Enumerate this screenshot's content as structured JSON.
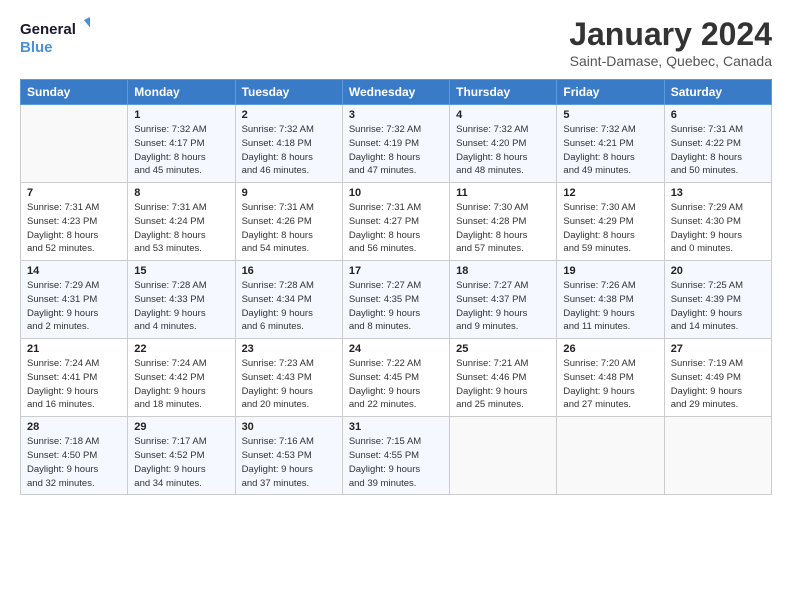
{
  "logo": {
    "line1": "General",
    "line2": "Blue"
  },
  "title": "January 2024",
  "subtitle": "Saint-Damase, Quebec, Canada",
  "days_header": [
    "Sunday",
    "Monday",
    "Tuesday",
    "Wednesday",
    "Thursday",
    "Friday",
    "Saturday"
  ],
  "weeks": [
    [
      {
        "num": "",
        "info": ""
      },
      {
        "num": "1",
        "info": "Sunrise: 7:32 AM\nSunset: 4:17 PM\nDaylight: 8 hours\nand 45 minutes."
      },
      {
        "num": "2",
        "info": "Sunrise: 7:32 AM\nSunset: 4:18 PM\nDaylight: 8 hours\nand 46 minutes."
      },
      {
        "num": "3",
        "info": "Sunrise: 7:32 AM\nSunset: 4:19 PM\nDaylight: 8 hours\nand 47 minutes."
      },
      {
        "num": "4",
        "info": "Sunrise: 7:32 AM\nSunset: 4:20 PM\nDaylight: 8 hours\nand 48 minutes."
      },
      {
        "num": "5",
        "info": "Sunrise: 7:32 AM\nSunset: 4:21 PM\nDaylight: 8 hours\nand 49 minutes."
      },
      {
        "num": "6",
        "info": "Sunrise: 7:31 AM\nSunset: 4:22 PM\nDaylight: 8 hours\nand 50 minutes."
      }
    ],
    [
      {
        "num": "7",
        "info": "Sunrise: 7:31 AM\nSunset: 4:23 PM\nDaylight: 8 hours\nand 52 minutes."
      },
      {
        "num": "8",
        "info": "Sunrise: 7:31 AM\nSunset: 4:24 PM\nDaylight: 8 hours\nand 53 minutes."
      },
      {
        "num": "9",
        "info": "Sunrise: 7:31 AM\nSunset: 4:26 PM\nDaylight: 8 hours\nand 54 minutes."
      },
      {
        "num": "10",
        "info": "Sunrise: 7:31 AM\nSunset: 4:27 PM\nDaylight: 8 hours\nand 56 minutes."
      },
      {
        "num": "11",
        "info": "Sunrise: 7:30 AM\nSunset: 4:28 PM\nDaylight: 8 hours\nand 57 minutes."
      },
      {
        "num": "12",
        "info": "Sunrise: 7:30 AM\nSunset: 4:29 PM\nDaylight: 8 hours\nand 59 minutes."
      },
      {
        "num": "13",
        "info": "Sunrise: 7:29 AM\nSunset: 4:30 PM\nDaylight: 9 hours\nand 0 minutes."
      }
    ],
    [
      {
        "num": "14",
        "info": "Sunrise: 7:29 AM\nSunset: 4:31 PM\nDaylight: 9 hours\nand 2 minutes."
      },
      {
        "num": "15",
        "info": "Sunrise: 7:28 AM\nSunset: 4:33 PM\nDaylight: 9 hours\nand 4 minutes."
      },
      {
        "num": "16",
        "info": "Sunrise: 7:28 AM\nSunset: 4:34 PM\nDaylight: 9 hours\nand 6 minutes."
      },
      {
        "num": "17",
        "info": "Sunrise: 7:27 AM\nSunset: 4:35 PM\nDaylight: 9 hours\nand 8 minutes."
      },
      {
        "num": "18",
        "info": "Sunrise: 7:27 AM\nSunset: 4:37 PM\nDaylight: 9 hours\nand 9 minutes."
      },
      {
        "num": "19",
        "info": "Sunrise: 7:26 AM\nSunset: 4:38 PM\nDaylight: 9 hours\nand 11 minutes."
      },
      {
        "num": "20",
        "info": "Sunrise: 7:25 AM\nSunset: 4:39 PM\nDaylight: 9 hours\nand 14 minutes."
      }
    ],
    [
      {
        "num": "21",
        "info": "Sunrise: 7:24 AM\nSunset: 4:41 PM\nDaylight: 9 hours\nand 16 minutes."
      },
      {
        "num": "22",
        "info": "Sunrise: 7:24 AM\nSunset: 4:42 PM\nDaylight: 9 hours\nand 18 minutes."
      },
      {
        "num": "23",
        "info": "Sunrise: 7:23 AM\nSunset: 4:43 PM\nDaylight: 9 hours\nand 20 minutes."
      },
      {
        "num": "24",
        "info": "Sunrise: 7:22 AM\nSunset: 4:45 PM\nDaylight: 9 hours\nand 22 minutes."
      },
      {
        "num": "25",
        "info": "Sunrise: 7:21 AM\nSunset: 4:46 PM\nDaylight: 9 hours\nand 25 minutes."
      },
      {
        "num": "26",
        "info": "Sunrise: 7:20 AM\nSunset: 4:48 PM\nDaylight: 9 hours\nand 27 minutes."
      },
      {
        "num": "27",
        "info": "Sunrise: 7:19 AM\nSunset: 4:49 PM\nDaylight: 9 hours\nand 29 minutes."
      }
    ],
    [
      {
        "num": "28",
        "info": "Sunrise: 7:18 AM\nSunset: 4:50 PM\nDaylight: 9 hours\nand 32 minutes."
      },
      {
        "num": "29",
        "info": "Sunrise: 7:17 AM\nSunset: 4:52 PM\nDaylight: 9 hours\nand 34 minutes."
      },
      {
        "num": "30",
        "info": "Sunrise: 7:16 AM\nSunset: 4:53 PM\nDaylight: 9 hours\nand 37 minutes."
      },
      {
        "num": "31",
        "info": "Sunrise: 7:15 AM\nSunset: 4:55 PM\nDaylight: 9 hours\nand 39 minutes."
      },
      {
        "num": "",
        "info": ""
      },
      {
        "num": "",
        "info": ""
      },
      {
        "num": "",
        "info": ""
      }
    ]
  ]
}
